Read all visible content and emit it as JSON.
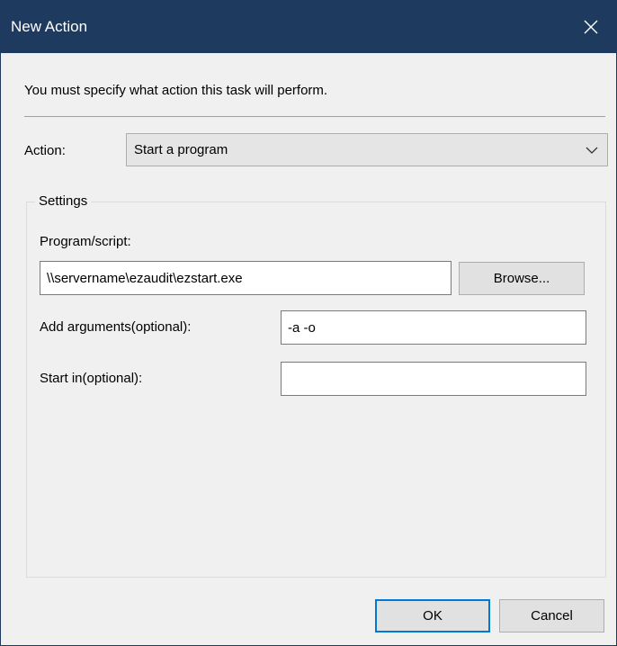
{
  "window": {
    "title": "New Action"
  },
  "instruction": "You must specify what action this task will perform.",
  "action": {
    "label": "Action:",
    "selected": "Start a program"
  },
  "settings": {
    "group_label": "Settings",
    "program": {
      "label": "Program/script:",
      "value": "\\\\servername\\ezaudit\\ezstart.exe",
      "browse_label": "Browse..."
    },
    "arguments": {
      "label": "Add arguments(optional):",
      "value": "-a -o"
    },
    "start_in": {
      "label": "Start in(optional):",
      "value": ""
    }
  },
  "buttons": {
    "ok": "OK",
    "cancel": "Cancel"
  },
  "colors": {
    "titlebar": "#1e3a5f",
    "dialog_bg": "#f0f0f0",
    "focus_border": "#0078d7"
  },
  "icons": {
    "close": "close-icon",
    "dropdown": "chevron-down-icon"
  }
}
